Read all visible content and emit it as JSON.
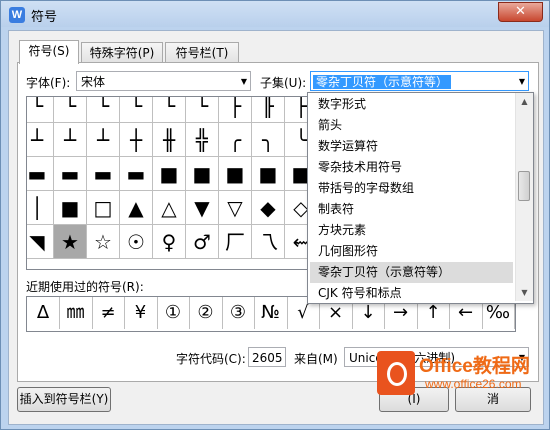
{
  "window": {
    "title": "符号",
    "close_glyph": "✕",
    "app_icon_letter": "W"
  },
  "tabs": [
    {
      "label": "符号(S)"
    },
    {
      "label": "特殊字符(P)"
    },
    {
      "label": "符号栏(T)"
    }
  ],
  "font": {
    "label": "字体(F):",
    "value": "宋体"
  },
  "subset": {
    "label": "子集(U):",
    "value": "零杂丁贝符（示意符等）"
  },
  "grid": [
    [
      "└",
      "└",
      "└",
      "└",
      "└",
      "└",
      "├",
      "╟",
      "├"
    ],
    [
      "┴",
      "┴",
      "┴",
      "┼",
      "╫",
      "╬",
      "╭",
      "╮",
      "╰"
    ],
    [
      "▬",
      "▬",
      "▬",
      "▬",
      "■",
      "■",
      "■",
      "■",
      "■"
    ],
    [
      "│",
      "■",
      "□",
      "▲",
      "△",
      "▼",
      "▽",
      "◆",
      "◇"
    ],
    [
      "◥",
      "★",
      "☆",
      "☉",
      "♀",
      "♂",
      "厂",
      "乁",
      "⇜"
    ]
  ],
  "subset_list": [
    "数字形式",
    "箭头",
    "数学运算符",
    "零杂技术用符号",
    "带括号的字母数组",
    "制表符",
    "方块元素",
    "几何图形符",
    "零杂丁贝符（示意符等）",
    "CJK 符号和标点"
  ],
  "recent": {
    "label": "近期使用过的符号(R):",
    "symbols": [
      "Δ",
      "㎜",
      "≠",
      "¥",
      "①",
      "②",
      "③",
      "№",
      "√",
      "×",
      "↓",
      "→",
      "↑",
      "←",
      "‰"
    ]
  },
  "char_code": {
    "label": "字符代码(C):",
    "value": "2605"
  },
  "from": {
    "label": "来自(M)",
    "value": "Unicode(十六进制)"
  },
  "buttons": {
    "insert_to_bar": "插入到符号栏(Y)",
    "insert_partial": "(I)",
    "cancel_partial": "消"
  },
  "watermark": {
    "line1": "Office教程网",
    "line2": "www.office26.com"
  }
}
